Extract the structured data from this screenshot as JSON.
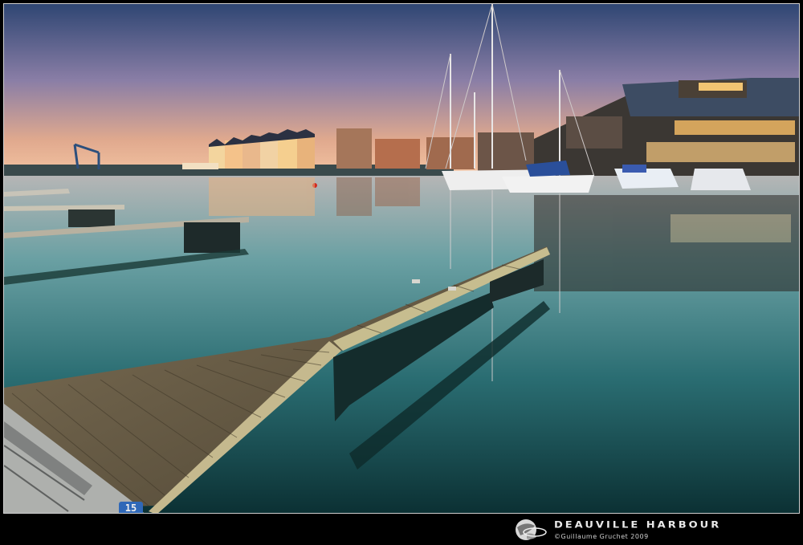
{
  "photo": {
    "title": "DEAUVILLE HARBOUR",
    "credit": "©Guillaume Gruchet 2009",
    "berth_number": "15",
    "colors": {
      "sky_top": "#2e4a7a",
      "sky_mid": "#9b86a8",
      "sky_horizon": "#f0b58a",
      "water_top": "#9fb0b8",
      "water_mid": "#3f8a8e",
      "water_bottom": "#0e3a3e",
      "dock_wood": "#6b5e44",
      "dock_rail": "#c9c2a0",
      "frame": "#000000"
    }
  }
}
